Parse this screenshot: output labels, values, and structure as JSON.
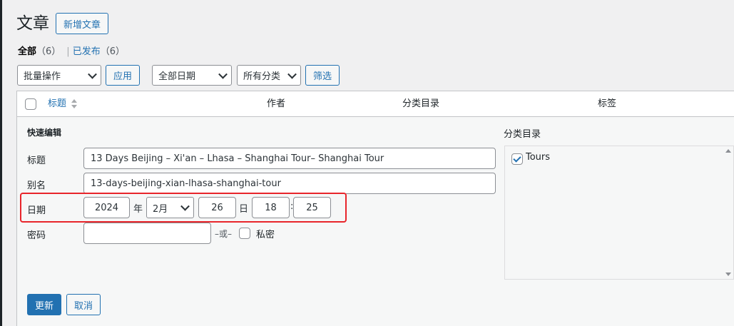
{
  "page": {
    "title": "文章",
    "add_new": "新增文章"
  },
  "views": {
    "all_label": "全部",
    "all_count": "（6）",
    "separator": "|",
    "published_label": "已发布",
    "published_count": "（6）"
  },
  "toolbar": {
    "bulk_actions": "批量操作",
    "apply": "应用",
    "all_dates": "全部日期",
    "all_categories": "所有分类",
    "filter": "筛选"
  },
  "table": {
    "columns": {
      "title": "标题",
      "author": "作者",
      "categories": "分类目录",
      "tags": "标签"
    }
  },
  "quick_edit": {
    "heading": "快速编辑",
    "title_label": "标题",
    "title_value": "13 Days Beijing – Xi'an – Lhasa – Shanghai Tour– Shanghai Tour",
    "slug_label": "别名",
    "slug_value": "13-days-beijing-xian-lhasa-shanghai-tour",
    "date_label": "日期",
    "year": "2024",
    "year_unit": "年",
    "month": "2月",
    "day": "26",
    "day_unit": "日",
    "hour": "18",
    "time_sep": ":",
    "minute": "25",
    "password_label": "密码",
    "password_value": "",
    "or_text": "–或–",
    "private_label": "私密",
    "categories_heading": "分类目录",
    "category_item": "Tours",
    "update": "更新",
    "cancel": "取消"
  },
  "colors": {
    "accent": "#2271b1",
    "highlight": "#e8252b"
  }
}
